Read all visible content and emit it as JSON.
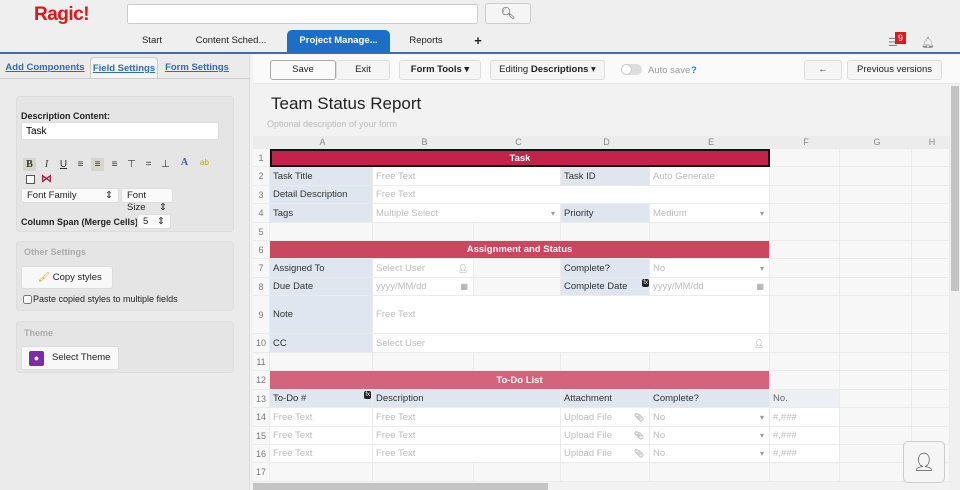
{
  "app": {
    "logo": "Ragic"
  },
  "search": {
    "placeholder": "",
    "button_icon": "search-icon"
  },
  "nav_tabs": [
    {
      "label": "Start"
    },
    {
      "label": "Content Sched..."
    },
    {
      "label": "Project Manage...",
      "active": true
    },
    {
      "label": "Reports"
    },
    {
      "label": "+"
    }
  ],
  "notifications": {
    "badge": "9"
  },
  "left_panel": {
    "tabs": [
      "Add Components",
      "Field Settings",
      "Form Settings"
    ],
    "active_tab": "Field Settings",
    "description_label": "Description Content:",
    "description_value": "Task",
    "font_family": "Font Family",
    "font_size": "Font Size",
    "column_span_label": "Column Span (Merge Cells):",
    "column_span_value": "5",
    "other_settings_title": "Other Settings",
    "copy_styles": "Copy styles",
    "paste_label": "Paste copied styles to multiple fields",
    "theme_title": "Theme",
    "select_theme": "Select Theme"
  },
  "toolbar": {
    "save": "Save",
    "exit": "Exit",
    "form_tools": "Form Tools",
    "editing_prefix": "Editing",
    "editing_mode": "Descriptions",
    "auto_save": "Auto save",
    "help": "?",
    "back": "←",
    "previous_versions": "Previous versions"
  },
  "form": {
    "title": "Team Status Report",
    "description_placeholder": "Optional description of your form",
    "columns": [
      "A",
      "B",
      "C",
      "D",
      "E",
      "F",
      "G",
      "H"
    ],
    "rows": [
      "1",
      "2",
      "3",
      "4",
      "5",
      "6",
      "7",
      "8",
      "9",
      "10",
      "11",
      "12",
      "13",
      "14",
      "15",
      "16",
      "17"
    ],
    "sections": {
      "task": "Task",
      "assignment": "Assignment and Status",
      "todo": "To-Do List"
    },
    "colors": {
      "task": "#c3224a",
      "assignment": "#c9475f",
      "todo": "#d4647b",
      "label_bg": "#dfe6ef"
    },
    "fields": {
      "task_title": "Task Title",
      "task_title_ph": "Free Text",
      "task_id": "Task ID",
      "task_id_ph": "Auto Generate",
      "detail": "Detail Description",
      "detail_ph": "Free Text",
      "tags": "Tags",
      "tags_ph": "Multiple Select",
      "priority": "Priority",
      "priority_ph": "Medium",
      "assigned": "Assigned To",
      "assigned_ph": "Select User",
      "complete": "Complete?",
      "complete_ph": "No",
      "due": "Due Date",
      "due_ph": "yyyy/MM/dd",
      "complete_date": "Complete Date",
      "complete_date_ph": "yyyy/MM/dd",
      "note": "Note",
      "note_ph": "Free Text",
      "cc": "CC",
      "cc_ph": "Select User"
    },
    "todo": {
      "headers": [
        "To-Do #",
        "Description",
        "Attachment",
        "Complete?",
        "No."
      ],
      "rows": [
        [
          "Free Text",
          "Free Text",
          "Upload File",
          "No",
          "#,###"
        ],
        [
          "Free Text",
          "Free Text",
          "Upload File",
          "No",
          "#,###"
        ],
        [
          "Free Text",
          "Free Text",
          "Upload File",
          "No",
          "#,###"
        ]
      ]
    },
    "fx_label": "fx"
  }
}
